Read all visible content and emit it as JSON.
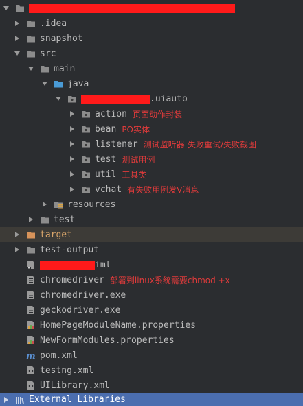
{
  "tree": {
    "root_hidden": "",
    "rows": [
      {
        "label": ".idea"
      },
      {
        "label": "snapshot"
      },
      {
        "label": "src"
      },
      {
        "label": "main"
      },
      {
        "label": "java"
      },
      {
        "label": ".uiauto"
      },
      {
        "label": "action",
        "note": "页面动作封装"
      },
      {
        "label": "bean",
        "note": "PO实体"
      },
      {
        "label": "listener",
        "note": "测试监听器-失败重试/失败截图"
      },
      {
        "label": "test",
        "note": "测试用例"
      },
      {
        "label": "util",
        "note": "工具类"
      },
      {
        "label": "vchat",
        "note": "有失败用例发V消息"
      },
      {
        "label": "resources"
      },
      {
        "label": "test"
      },
      {
        "label": "target"
      },
      {
        "label": "test-output"
      },
      {
        "label": "iml"
      },
      {
        "label": "chromedriver",
        "note": "部署到linux系统需要chmod +x"
      },
      {
        "label": "chromedriver.exe"
      },
      {
        "label": "geckodriver.exe"
      },
      {
        "label": "HomePageModuleName.properties"
      },
      {
        "label": "NewFormModules.properties"
      },
      {
        "label": "pom.xml"
      },
      {
        "label": "testng.xml"
      },
      {
        "label": "UILibrary.xml"
      },
      {
        "label": "External Libraries"
      }
    ]
  },
  "colors": {
    "background": "#2b2d30",
    "selected_row": "#3d3b37",
    "highlight_row": "#4b6eaf",
    "redaction": "#ff1a1a",
    "annotation": "#e03b3b",
    "folder": "#8c8c8c",
    "source_folder": "#4a9bd6",
    "excluded_folder": "#d7935a"
  }
}
